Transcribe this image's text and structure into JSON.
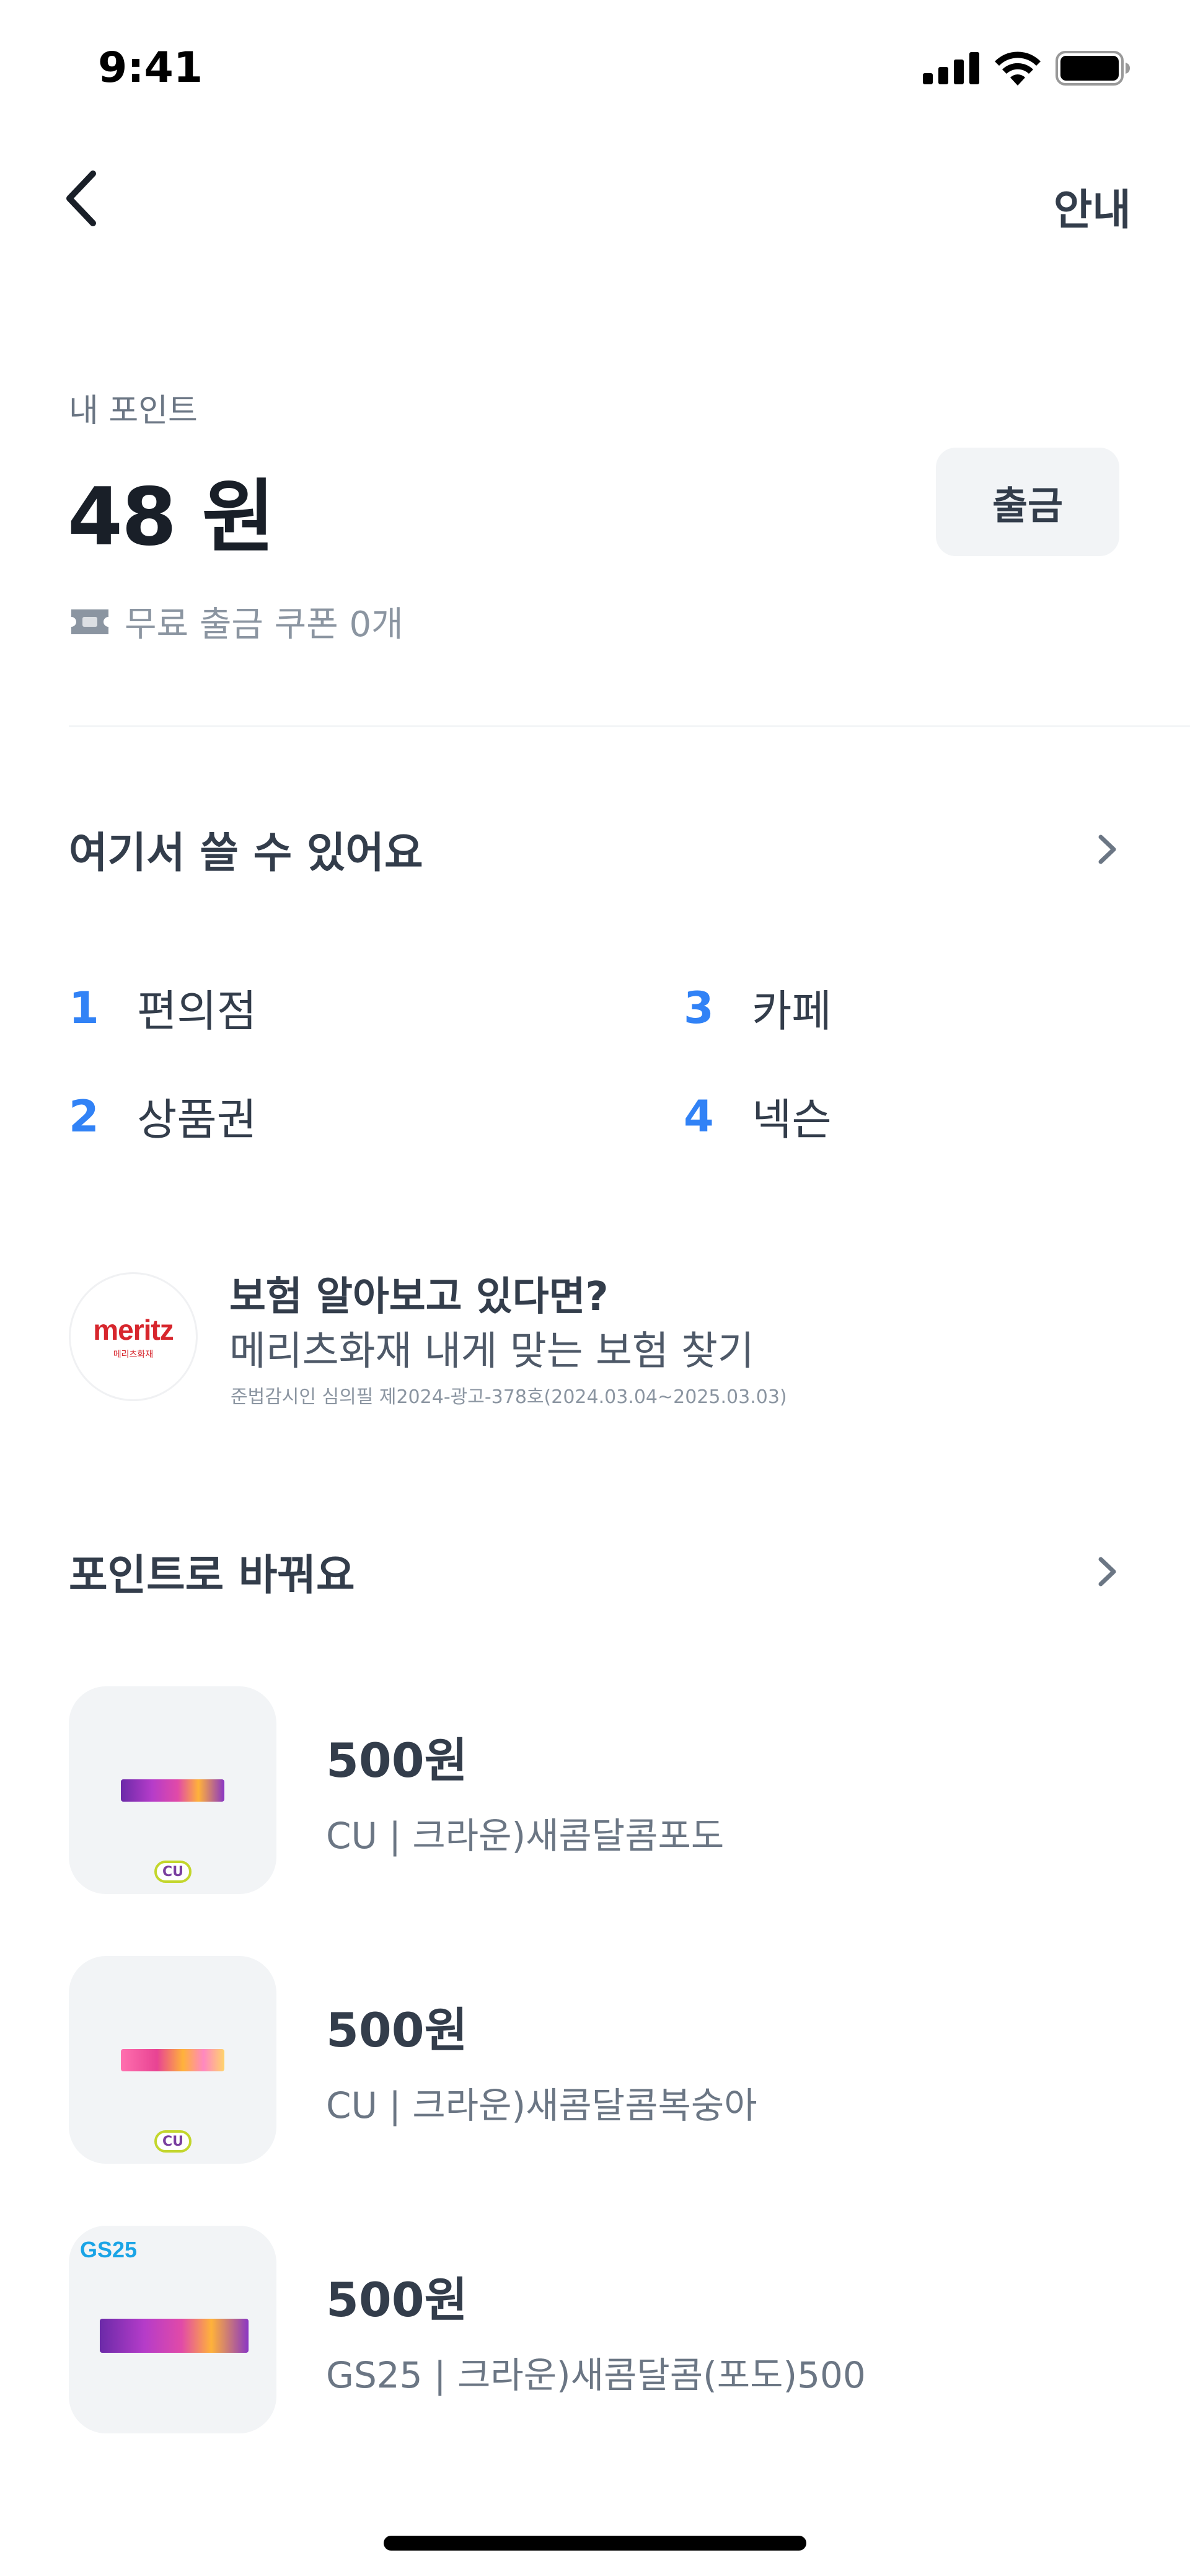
{
  "status_bar": {
    "time": "9:41"
  },
  "nav": {
    "guide_label": "안내"
  },
  "points": {
    "label": "내 포인트",
    "value": "48 원",
    "withdraw_label": "출금",
    "coupon_text": "무료 출금 쿠폰 0개"
  },
  "usable": {
    "title": "여기서 쓸 수 있어요",
    "items": [
      {
        "num": "1",
        "label": "편의점"
      },
      {
        "num": "2",
        "label": "상품권"
      },
      {
        "num": "3",
        "label": "카페"
      },
      {
        "num": "4",
        "label": "넥슨"
      }
    ]
  },
  "ad": {
    "logo_text": "meritz",
    "logo_sub": "메리츠화재",
    "title": "보험 알아보고 있다면?",
    "desc": "메리츠화재 내게 맞는 보험 찾기",
    "note": "준법감시인 심의필 제2024-광고-378호(2024.03.04~2025.03.03)"
  },
  "exchange": {
    "title": "포인트로 바꿔요",
    "products": [
      {
        "price": "500원",
        "name": "CU | 크라운)새콤달콤포도",
        "badge": "CU"
      },
      {
        "price": "500원",
        "name": "CU | 크라운)새콤달콤복숭아",
        "badge": "CU"
      },
      {
        "price": "500원",
        "name": "GS25 | 크라운)새콤달콤(포도)500",
        "badge": "GS25"
      }
    ]
  },
  "colors": {
    "accent": "#3182f6",
    "text": "#333d4b",
    "muted": "#8b95a1",
    "button_bg": "#f2f4f6"
  }
}
